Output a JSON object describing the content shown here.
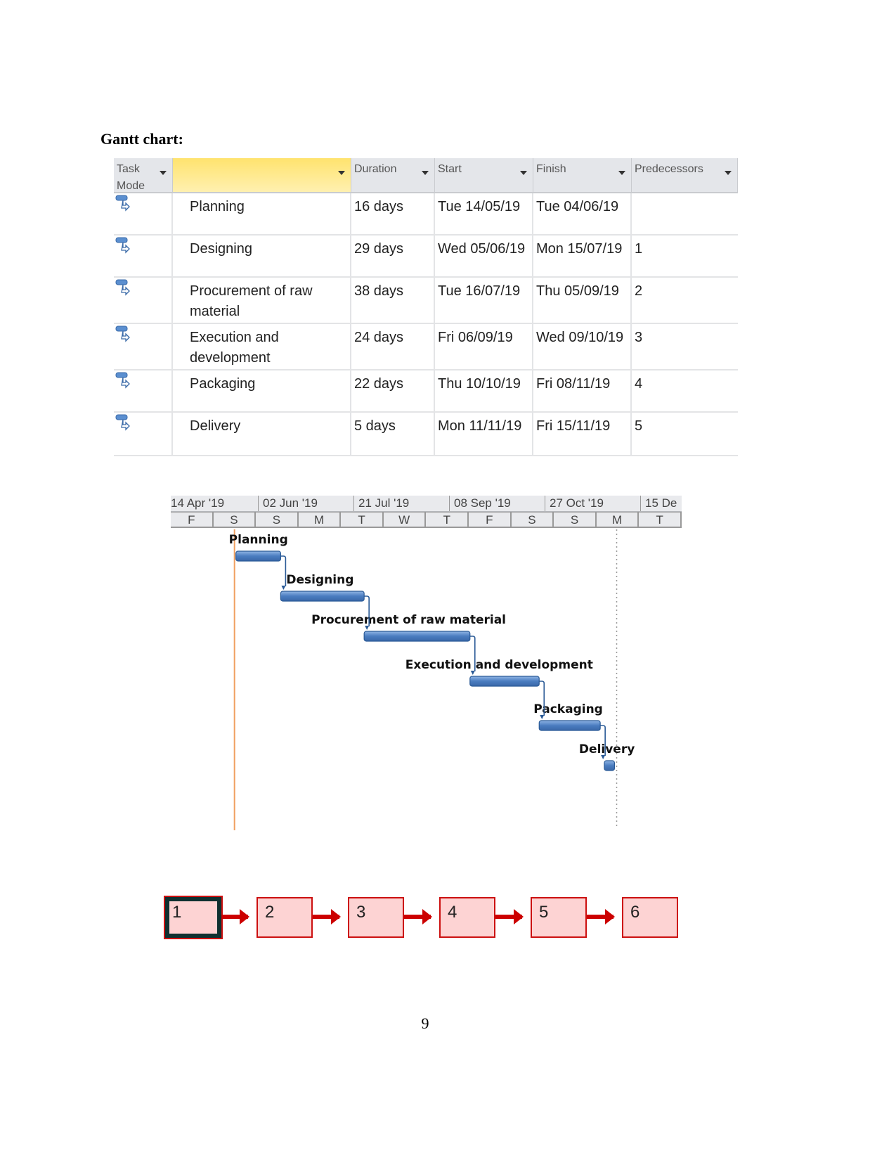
{
  "heading": "Gantt chart:",
  "table": {
    "headers": [
      "Task Mode",
      "",
      "Duration",
      "Start",
      "Finish",
      "Predecessors"
    ],
    "rows": [
      {
        "mode_icon": "auto-scheduled-task-icon",
        "name": "Planning",
        "duration": "16 days",
        "start": "Tue 14/05/19",
        "finish": "Tue 04/06/19",
        "predecessors": ""
      },
      {
        "mode_icon": "auto-scheduled-task-icon",
        "name": "Designing",
        "duration": "29 days",
        "start": "Wed 05/06/19",
        "finish": "Mon 15/07/19",
        "predecessors": "1"
      },
      {
        "mode_icon": "auto-scheduled-task-icon",
        "name": "Procurement of raw material",
        "duration": "38 days",
        "start": "Tue 16/07/19",
        "finish": "Thu 05/09/19",
        "predecessors": "2"
      },
      {
        "mode_icon": "auto-scheduled-task-icon",
        "name": "Execution and development",
        "duration": "24 days",
        "start": "Fri 06/09/19",
        "finish": "Wed 09/10/19",
        "predecessors": "3"
      },
      {
        "mode_icon": "auto-scheduled-task-icon",
        "name": "Packaging",
        "duration": "22 days",
        "start": "Thu 10/10/19",
        "finish": "Fri 08/11/19",
        "predecessors": "4"
      },
      {
        "mode_icon": "auto-scheduled-task-icon",
        "name": "Delivery",
        "duration": "5 days",
        "start": "Mon 11/11/19",
        "finish": "Fri 15/11/19",
        "predecessors": "5"
      }
    ]
  },
  "chart_data": {
    "type": "gantt",
    "timescale_major": [
      "14 Apr '19",
      "02 Jun '19",
      "21 Jul '19",
      "08 Sep '19",
      "27 Oct '19",
      "15 De"
    ],
    "timescale_minor": [
      "F",
      "S",
      "S",
      "M",
      "T",
      "W",
      "T",
      "F",
      "S",
      "S",
      "M",
      "T"
    ],
    "tasks": [
      {
        "name": "Planning",
        "start": "2019-05-14",
        "finish": "2019-06-04",
        "predecessor": null
      },
      {
        "name": "Designing",
        "start": "2019-06-05",
        "finish": "2019-07-15",
        "predecessor": 1
      },
      {
        "name": "Procurement of raw material",
        "start": "2019-07-16",
        "finish": "2019-09-05",
        "predecessor": 2
      },
      {
        "name": "Execution and development",
        "start": "2019-09-06",
        "finish": "2019-10-09",
        "predecessor": 3
      },
      {
        "name": "Packaging",
        "start": "2019-10-10",
        "finish": "2019-11-08",
        "predecessor": 4
      },
      {
        "name": "Delivery",
        "start": "2019-11-11",
        "finish": "2019-11-15",
        "predecessor": 5
      }
    ],
    "axis_start": "2019-04-12",
    "axis_days_visible": 251,
    "colors": {
      "bar": "#4a7cc0",
      "bar_border": "#2a5a96",
      "link": "#2a5a96",
      "project_start_line": "#f0a060",
      "deadline_line": "#999999"
    }
  },
  "network": {
    "nodes": [
      "1",
      "2",
      "3",
      "4",
      "5",
      "6"
    ],
    "colors": {
      "fill": "#fdd3d3",
      "border": "#cc1010",
      "arrow": "#cc0000",
      "critical_border": "#0f3030"
    }
  },
  "page_number": "9"
}
